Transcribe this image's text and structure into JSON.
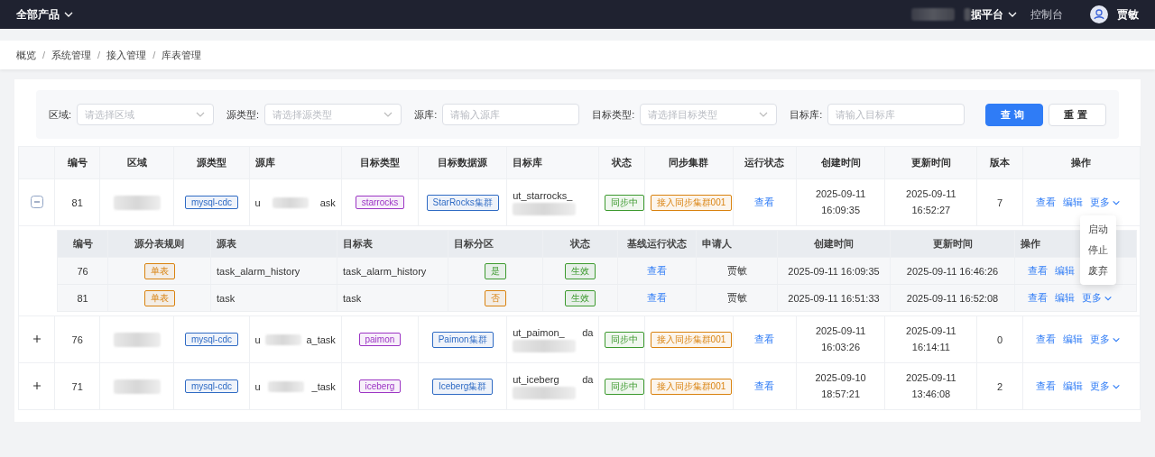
{
  "top_bar": {
    "product_menu": "全部产品",
    "platform": "据平台",
    "console": "控制台",
    "user": "贾敏"
  },
  "breadcrumb": {
    "separator": "/",
    "items": [
      "概览",
      "系统管理",
      "接入管理",
      "库表管理"
    ]
  },
  "filters": [
    {
      "label": "区域:",
      "kind": "select",
      "placeholder": "请选择区域"
    },
    {
      "label": "源类型:",
      "kind": "select",
      "placeholder": "请选择源类型"
    },
    {
      "label": "源库:",
      "kind": "input",
      "placeholder": "请输入源库"
    },
    {
      "label": "目标类型:",
      "kind": "select",
      "placeholder": "请选择目标类型"
    },
    {
      "label": "目标库:",
      "kind": "input",
      "placeholder": "请输入目标库"
    }
  ],
  "buttons": [
    {
      "label": "查询",
      "kind": "primary"
    },
    {
      "label": "重置",
      "kind": "default"
    }
  ],
  "table": {
    "columns": [
      "编号",
      "区域",
      "源类型",
      "源库",
      "目标类型",
      "目标数据源",
      "目标库",
      "状态",
      "同步集群",
      "运行状态",
      "创建时间",
      "更新时间",
      "版本",
      "操作"
    ],
    "rows": [
      {
        "expanded": true,
        "id": "81",
        "source_type": {
          "text": "mysql-cdc",
          "color": "#2f6bc4"
        },
        "source_db": [
          "u",
          "ask"
        ],
        "target_type": {
          "text": "starrocks",
          "color": "#9c35c4"
        },
        "target_source": {
          "text": "StarRocks集群",
          "color": "#2f6bc4"
        },
        "target_db": [
          "ut_starrocks_"
        ],
        "status": {
          "text": "同步中",
          "color": "#3d9a2f"
        },
        "cluster": {
          "text": "接入同步集群001",
          "color": "#d9820f"
        },
        "run_status": "查看",
        "created": "2025-09-11 16:09:35",
        "updated": "2025-09-11 16:52:27",
        "version": "7",
        "actions": [
          "查看",
          "编辑",
          "更多"
        ],
        "menu": [
          "启动",
          "停止",
          "废弃"
        ],
        "children": {
          "columns": [
            "编号",
            "源分表规则",
            "源表",
            "目标表",
            "目标分区",
            "状态",
            "基线运行状态",
            "申请人",
            "创建时间",
            "更新时间",
            "操作"
          ],
          "rows": [
            {
              "id": "76",
              "rule": {
                "text": "单表",
                "color": "#d9820f"
              },
              "source_table": "task_alarm_history",
              "target_table": "task_alarm_history",
              "partition": {
                "text": "是",
                "color": "#3d9a2f"
              },
              "status": {
                "text": "生效",
                "color": "#3d9a2f"
              },
              "baseline": "查看",
              "applicant": "贾敏",
              "created": "2025-09-11 16:09:35",
              "updated": "2025-09-11 16:46:26",
              "actions": [
                "查看",
                "编辑"
              ]
            },
            {
              "id": "81",
              "rule": {
                "text": "单表",
                "color": "#d9820f"
              },
              "source_table": "task",
              "target_table": "task",
              "partition": {
                "text": "否",
                "color": "#d9820f"
              },
              "status": {
                "text": "生效",
                "color": "#3d9a2f"
              },
              "baseline": "查看",
              "applicant": "贾敏",
              "created": "2025-09-11 16:51:33",
              "updated": "2025-09-11 16:52:08",
              "actions": [
                "查看",
                "编辑",
                "更多"
              ]
            }
          ]
        }
      },
      {
        "expanded": false,
        "id": "76",
        "source_type": {
          "text": "mysql-cdc",
          "color": "#2f6bc4"
        },
        "source_db": [
          "u",
          "a_task"
        ],
        "target_type": {
          "text": "paimon",
          "color": "#9c35c4"
        },
        "target_source": {
          "text": "Paimon集群",
          "color": "#2f6bc4"
        },
        "target_db": [
          "ut_paimon_",
          "da"
        ],
        "status": {
          "text": "同步中",
          "color": "#3d9a2f"
        },
        "cluster": {
          "text": "接入同步集群001",
          "color": "#d9820f"
        },
        "run_status": "查看",
        "created": "2025-09-11 16:03:26",
        "updated": "2025-09-11 16:14:11",
        "version": "0",
        "actions": [
          "查看",
          "编辑",
          "更多"
        ]
      },
      {
        "expanded": false,
        "id": "71",
        "source_type": {
          "text": "mysql-cdc",
          "color": "#2f6bc4"
        },
        "source_db": [
          "u",
          "_task"
        ],
        "target_type": {
          "text": "iceberg",
          "color": "#9c35c4"
        },
        "target_source": {
          "text": "Iceberg集群",
          "color": "#2f6bc4"
        },
        "target_db": [
          "ut_iceberg",
          "da"
        ],
        "status": {
          "text": "同步中",
          "color": "#3d9a2f"
        },
        "cluster": {
          "text": "接入同步集群001",
          "color": "#d9820f"
        },
        "run_status": "查看",
        "created": "2025-09-10 18:57:21",
        "updated": "2025-09-11 13:46:08",
        "version": "2",
        "actions": [
          "查看",
          "编辑",
          "更多"
        ]
      }
    ]
  }
}
